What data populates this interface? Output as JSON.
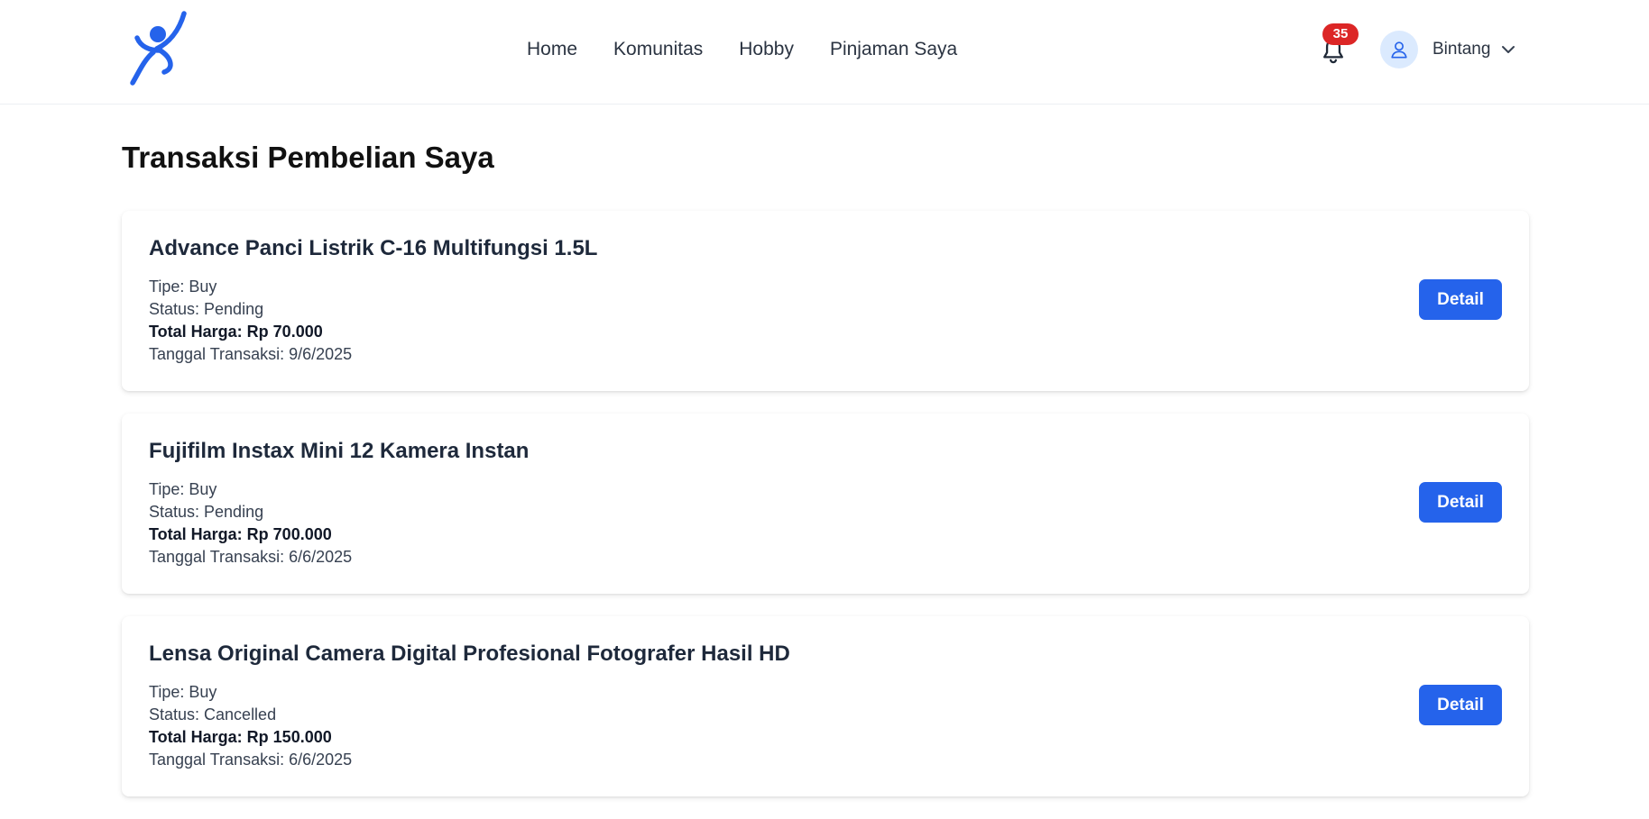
{
  "nav": {
    "logo_icon": "person-figure-logo-icon",
    "brand_color": "#2563eb",
    "links": [
      {
        "label": "Home"
      },
      {
        "label": "Komunitas"
      },
      {
        "label": "Hobby"
      },
      {
        "label": "Pinjaman Saya"
      }
    ],
    "notification": {
      "icon": "bell-icon",
      "count": "35",
      "badge_color": "#dc2626"
    },
    "user": {
      "avatar_icon": "user-icon",
      "name": "Bintang",
      "dropdown_icon": "chevron-down-icon"
    }
  },
  "page": {
    "title": "Transaksi Pembelian Saya"
  },
  "transactions": [
    {
      "name": "Advance Panci Listrik C-16 Multifungsi 1.5L",
      "type": "Tipe: Buy",
      "status": "Status: Pending",
      "total": "Total Harga: Rp 70.000",
      "date": "Tanggal Transaksi: 9/6/2025",
      "button_label": "Detail"
    },
    {
      "name": "Fujifilm Instax Mini 12 Kamera Instan",
      "type": "Tipe: Buy",
      "status": "Status: Pending",
      "total": "Total Harga: Rp 700.000",
      "date": "Tanggal Transaksi: 6/6/2025",
      "button_label": "Detail"
    },
    {
      "name": "Lensa Original Camera Digital Profesional Fotografer Hasil HD",
      "type": "Tipe: Buy",
      "status": "Status: Cancelled",
      "total": "Total Harga: Rp 150.000",
      "date": "Tanggal Transaksi: 6/6/2025",
      "button_label": "Detail"
    }
  ]
}
